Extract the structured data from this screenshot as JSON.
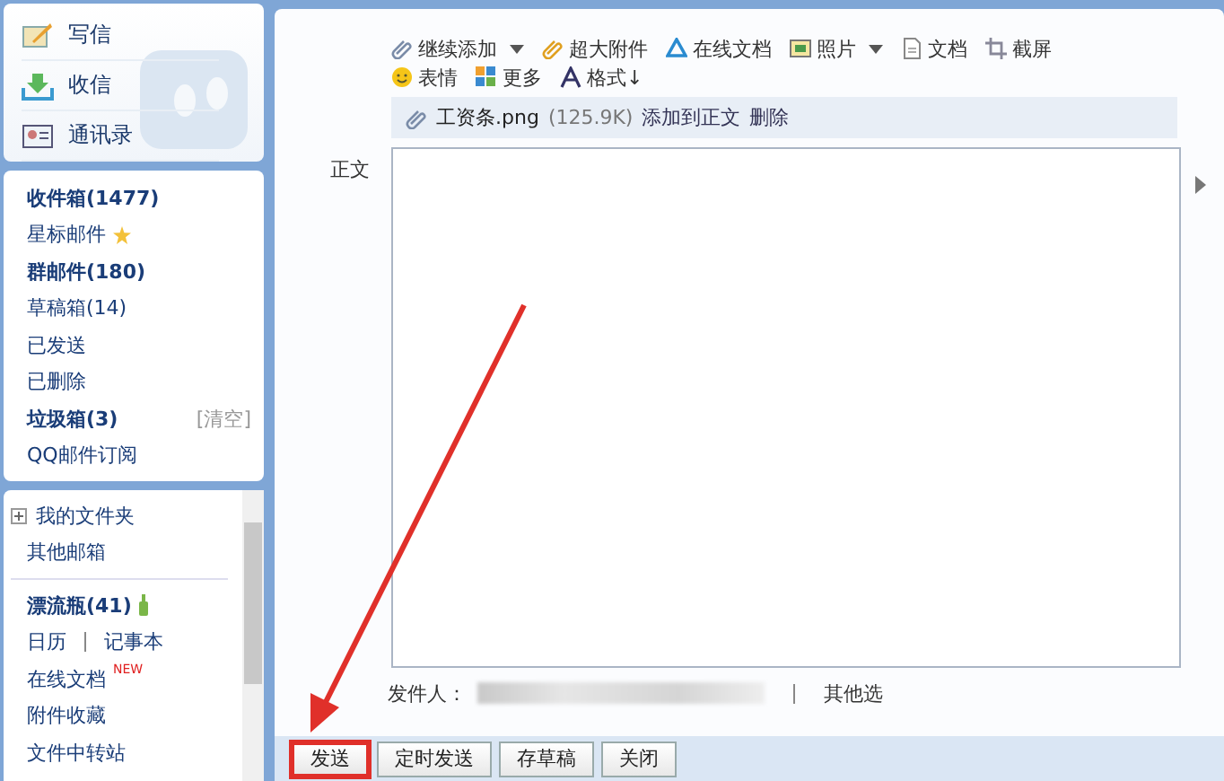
{
  "sidebar": {
    "actions": [
      {
        "label": "写信",
        "kind": "write"
      },
      {
        "label": "收信",
        "kind": "receive"
      },
      {
        "label": "通讯录",
        "kind": "contacts"
      }
    ],
    "folders": [
      {
        "label": "收件箱(1477)",
        "unread": true,
        "kind": "plain"
      },
      {
        "label": "星标邮件",
        "unread": false,
        "kind": "starred"
      },
      {
        "label": "群邮件(180)",
        "unread": true,
        "kind": "plain"
      },
      {
        "label": "草稿箱(14)",
        "unread": false,
        "kind": "plain"
      },
      {
        "label": "已发送",
        "unread": false,
        "kind": "plain"
      },
      {
        "label": "已删除",
        "unread": false,
        "kind": "plain"
      },
      {
        "label": "垃圾箱(3)",
        "unread": true,
        "kind": "plain",
        "action": "[清空]"
      },
      {
        "label": "QQ邮件订阅",
        "unread": false,
        "kind": "plain"
      }
    ],
    "my_folders": {
      "label": "我的文件夹",
      "expanded": false
    },
    "other_mailboxes": "其他邮箱",
    "apps": [
      {
        "labels": [
          "漂流瓶(41)"
        ],
        "unread": true,
        "kind": "bottle"
      },
      {
        "labels": [
          "日历",
          "记事本"
        ],
        "unread": false,
        "kind": "plain"
      },
      {
        "labels": [
          "在线文档"
        ],
        "unread": false,
        "kind": "plain",
        "badge": "NEW"
      },
      {
        "labels": [
          "附件收藏"
        ],
        "unread": false,
        "kind": "plain"
      },
      {
        "labels": [
          "文件中转站"
        ],
        "unread": false,
        "kind": "plain"
      }
    ]
  },
  "toolbar": [
    [
      {
        "label": "继续添加",
        "kind": "clip",
        "dropdown": true
      },
      {
        "label": "超大附件",
        "kind": "bigclip",
        "dropdown": false
      },
      {
        "label": "在线文档",
        "kind": "doc-online",
        "dropdown": false
      },
      {
        "label": "照片",
        "kind": "photo",
        "dropdown": true
      },
      {
        "label": "文档",
        "kind": "document",
        "dropdown": false
      },
      {
        "label": "截屏",
        "kind": "screenshot",
        "dropdown": false
      }
    ],
    [
      {
        "label": "表情",
        "kind": "emoji",
        "dropdown": false
      },
      {
        "label": "更多",
        "kind": "more",
        "dropdown": false
      },
      {
        "label": "格式↓",
        "kind": "format",
        "dropdown": false
      }
    ]
  ],
  "attachment": {
    "name": "工资条.png",
    "size": "(125.9K)",
    "actions": [
      "添加到正文",
      "删除"
    ]
  },
  "body_label": "正文",
  "sender": {
    "label": "发件人：",
    "other": "其他选"
  },
  "buttons": [
    {
      "label": "发送",
      "highlighted": true
    },
    {
      "label": "定时发送",
      "highlighted": false
    },
    {
      "label": "存草稿",
      "highlighted": false
    },
    {
      "label": "关闭",
      "highlighted": false
    }
  ]
}
